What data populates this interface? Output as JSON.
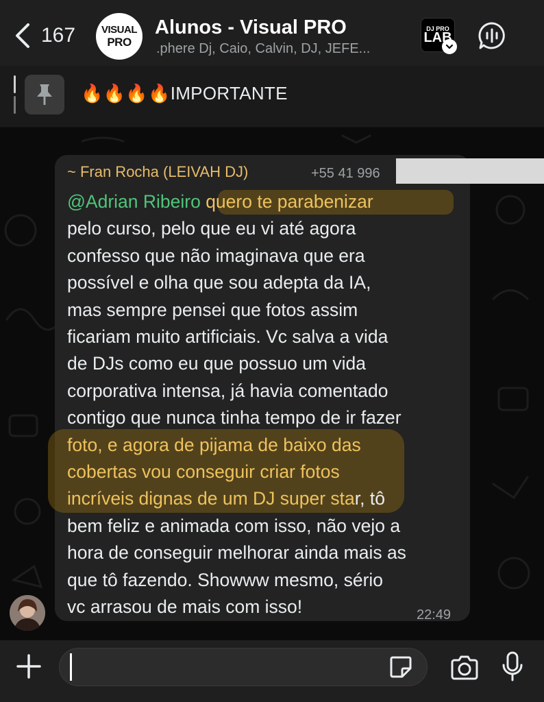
{
  "header": {
    "back_count": "167",
    "group_avatar_line1": "VISUAL",
    "group_avatar_line2": "PRO",
    "title": "Alunos - Visual PRO",
    "members": ".phere Dj, Caio, Calvin, DJ, JEFE...",
    "badge_line1": "DJ PRO",
    "badge_line2": "LAB"
  },
  "pinned": {
    "text": "🔥🔥🔥🔥IMPORTANTE"
  },
  "message": {
    "sender": "~ Fran Rocha (LEIVAH DJ)",
    "phone": "+55 41 996",
    "mention": "@Adrian Ribeiro",
    "line1_rest": " quero te parabenizar",
    "lines": [
      "pelo curso, pelo que eu vi até agora",
      "confesso que não imaginava que era",
      "possível e olha que sou adepta da IA,",
      "mas sempre pensei que fotos assim",
      "ficariam muito artificiais. Vc salva a vida",
      "de DJs como eu que possuo um vida",
      "corporativa intensa, já havia comentado",
      "contigo que nunca tinha tempo de ir fazer"
    ],
    "hl_line1": "foto, e agora de pijama de baixo das",
    "hl_line2": "cobertas vou conseguir criar fotos",
    "hl_line3_a": "incríveis dignas de um DJ super sta",
    "hl_line3_b": "r, tô",
    "tail_lines": [
      "bem feliz e animada com isso, não vejo a",
      "hora de conseguir melhorar ainda mais as",
      "que tô fazendo. Showww mesmo, sério",
      "vc arrasou de mais com isso!"
    ],
    "time": "22:49"
  },
  "composer": {
    "value": ""
  },
  "colors": {
    "mention": "#4fc47a",
    "sender": "#e8bc6a",
    "highlight": "#eec25d"
  },
  "icons": {
    "back": "chevron-left-icon",
    "pin": "pin-icon",
    "voice_chat": "voice-chat-icon",
    "plus": "plus-icon",
    "sticker": "sticker-icon",
    "camera": "camera-icon",
    "mic": "microphone-icon"
  }
}
